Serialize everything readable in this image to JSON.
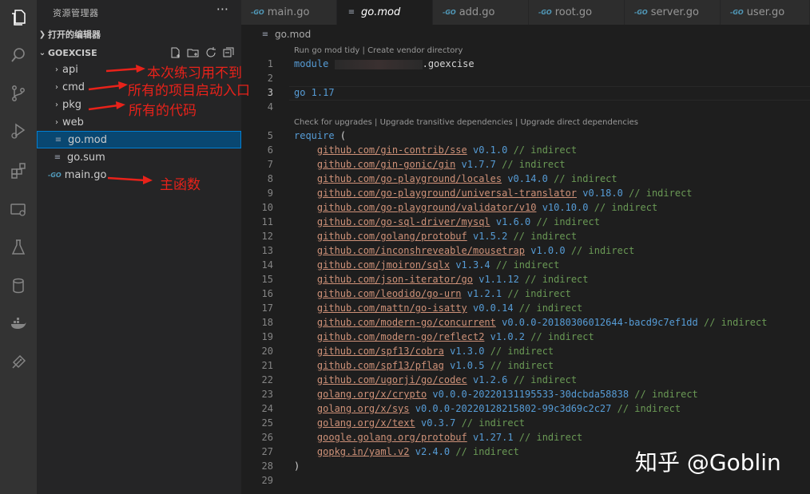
{
  "activity_bar": {
    "icons": [
      "files-icon",
      "search-icon",
      "source-control-icon",
      "run-debug-icon",
      "extensions-icon",
      "remote-explorer-icon",
      "testing-icon",
      "database-icon",
      "docker-icon",
      "rest-client-icon"
    ]
  },
  "sidebar": {
    "title": "资源管理器",
    "more": "···",
    "open_editors_label": "打开的编辑器",
    "folder_label": "GOEXCISE",
    "items": [
      {
        "label": "api",
        "kind": "folder"
      },
      {
        "label": "cmd",
        "kind": "folder"
      },
      {
        "label": "pkg",
        "kind": "folder"
      },
      {
        "label": "web",
        "kind": "folder"
      },
      {
        "label": "go.mod",
        "kind": "file",
        "selected": true
      },
      {
        "label": "go.sum",
        "kind": "file"
      },
      {
        "label": "main.go",
        "kind": "go"
      }
    ]
  },
  "annotations": [
    {
      "text": "本次练习用不到"
    },
    {
      "text": "所有的项目启动入口"
    },
    {
      "text": "所有的代码"
    },
    {
      "text": "主函数"
    }
  ],
  "tabs": [
    {
      "label": "main.go",
      "icon": "go-icon",
      "active": false
    },
    {
      "label": "go.mod",
      "icon": "file-lines-icon",
      "active": true
    },
    {
      "label": "add.go",
      "icon": "go-icon",
      "active": false
    },
    {
      "label": "root.go",
      "icon": "go-icon",
      "active": false
    },
    {
      "label": "server.go",
      "icon": "go-icon",
      "active": false
    },
    {
      "label": "user.go",
      "icon": "go-icon",
      "active": false
    }
  ],
  "go_icon_text": "-GO",
  "breadcrumb": {
    "file": "go.mod"
  },
  "editor": {
    "lens_top": "Run go mod tidy | Create vendor directory",
    "lens_require": "Check for upgrades | Upgrade transitive dependencies | Upgrade direct dependencies",
    "module_kw": "module",
    "module_suffix": ".goexcise",
    "go_line": "go 1.17",
    "require_kw": "require",
    "open_paren": " (",
    "close_paren": ")",
    "comment": "// indirect",
    "line_numbers": [
      "1",
      "2",
      "3",
      "4",
      "5",
      "6",
      "7",
      "8",
      "9",
      "10",
      "11",
      "12",
      "13",
      "14",
      "15",
      "16",
      "17",
      "18",
      "19",
      "20",
      "21",
      "22",
      "23",
      "24",
      "25",
      "26",
      "27",
      "28",
      "29"
    ],
    "requires": [
      {
        "path": "github.com/gin-contrib/sse",
        "version": "v0.1.0"
      },
      {
        "path": "github.com/gin-gonic/gin",
        "version": "v1.7.7"
      },
      {
        "path": "github.com/go-playground/locales",
        "version": "v0.14.0"
      },
      {
        "path": "github.com/go-playground/universal-translator",
        "version": "v0.18.0"
      },
      {
        "path": "github.com/go-playground/validator/v10",
        "version": "v10.10.0"
      },
      {
        "path": "github.com/go-sql-driver/mysql",
        "version": "v1.6.0"
      },
      {
        "path": "github.com/golang/protobuf",
        "version": "v1.5.2"
      },
      {
        "path": "github.com/inconshreveable/mousetrap",
        "version": "v1.0.0"
      },
      {
        "path": "github.com/jmoiron/sqlx",
        "version": "v1.3.4"
      },
      {
        "path": "github.com/json-iterator/go",
        "version": "v1.1.12"
      },
      {
        "path": "github.com/leodido/go-urn",
        "version": "v1.2.1"
      },
      {
        "path": "github.com/mattn/go-isatty",
        "version": "v0.0.14"
      },
      {
        "path": "github.com/modern-go/concurrent",
        "version": "v0.0.0-20180306012644-bacd9c7ef1dd"
      },
      {
        "path": "github.com/modern-go/reflect2",
        "version": "v1.0.2"
      },
      {
        "path": "github.com/spf13/cobra",
        "version": "v1.3.0"
      },
      {
        "path": "github.com/spf13/pflag",
        "version": "v1.0.5"
      },
      {
        "path": "github.com/ugorji/go/codec",
        "version": "v1.2.6"
      },
      {
        "path": "golang.org/x/crypto",
        "version": "v0.0.0-20220131195533-30dcbda58838"
      },
      {
        "path": "golang.org/x/sys",
        "version": "v0.0.0-20220128215802-99c3d69c2c27"
      },
      {
        "path": "golang.org/x/text",
        "version": "v0.3.7"
      },
      {
        "path": "google.golang.org/protobuf",
        "version": "v1.27.1"
      },
      {
        "path": "gopkg.in/yaml.v2",
        "version": "v2.4.0"
      }
    ]
  },
  "watermark": "知乎 @Goblin",
  "colors": {
    "annotation": "#e8221a",
    "link": "#ce9178",
    "keyword": "#569cd6",
    "comment": "#6a9955"
  }
}
